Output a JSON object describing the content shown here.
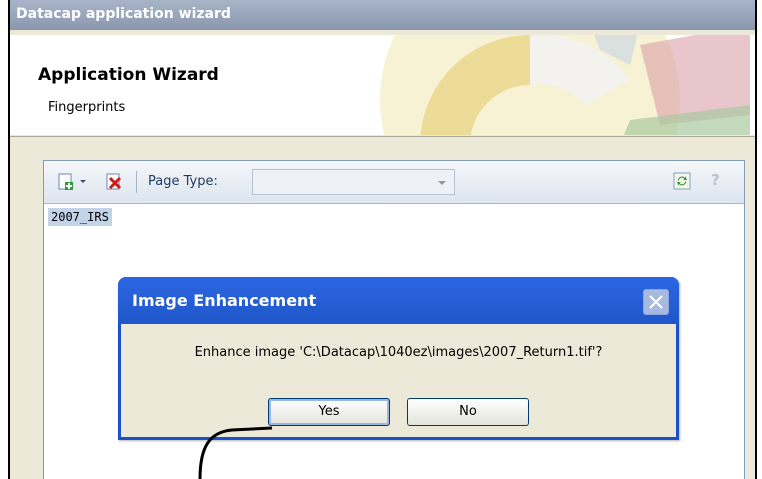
{
  "window": {
    "title": "Datacap application wizard",
    "heading": "Application Wizard",
    "subheading": "Fingerprints"
  },
  "toolbar": {
    "add_icon": "add-page-icon",
    "delete_icon": "delete-icon",
    "page_type_label": "Page Type:",
    "page_type_value": "",
    "refresh_icon": "refresh-icon",
    "help_icon": "?"
  },
  "list": {
    "items": [
      "2007_IRS"
    ]
  },
  "dialog": {
    "title": "Image Enhancement",
    "message": "Enhance image 'C:\\Datacap\\1040ez\\images\\2007_Return1.tif'?",
    "yes_label": "Yes",
    "no_label": "No"
  },
  "colors": {
    "dialog_title_bar": "#2c66e1",
    "dialog_body": "#ece9d8",
    "title_bar": "#a8b4c8",
    "selection": "#c3d3ea"
  }
}
